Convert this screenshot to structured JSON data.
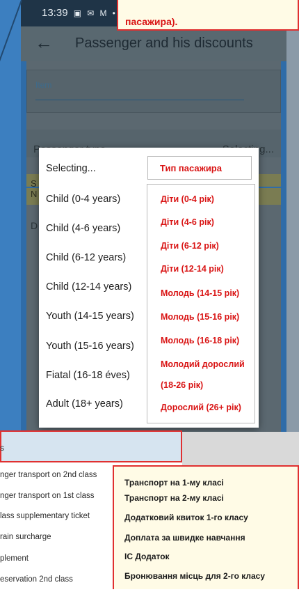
{
  "status_bar": {
    "time": "13:39",
    "icons": [
      "image-icon",
      "mail-icon",
      "gmail-icon",
      "dot-icon"
    ]
  },
  "header": {
    "back_glyph": "←",
    "title": "Passenger and his discounts"
  },
  "form": {
    "item_label": "Item",
    "passenger_type_label": "Passenger type",
    "passenger_type_value": "Selecting...",
    "band_line1": "S",
    "band_line2": "N",
    "d_line": "D"
  },
  "dropdown": {
    "options": [
      "Selecting...",
      "Child (0-4 years)",
      "Child (4-6 years)",
      "Child (6-12 years)",
      "Child (12-14 years)",
      "Youth (14-15 years)",
      "Youth (15-16 years)",
      "Fiatal (16-18 éves)",
      "Adult (18+  years)"
    ]
  },
  "annotations": {
    "top_note_line1": "",
    "top_note_line2": "пасажира).",
    "type_label": "Тип пасажира",
    "type_values": [
      "Діти (0-4 рік)",
      "Діти (4-6 рік)",
      "Діти (6-12 рік)",
      "Діти (12-14 рік)",
      "Молодь (14-15 рік)",
      "Молодь (15-16 рік)",
      "Молодь (16-18 рік)",
      "Молодий дорослий",
      "(18-26 рік)",
      "Дорослий (26+ рік)"
    ]
  },
  "bottom_list": {
    "header": "s",
    "rows": [
      "nger transport on 2nd class",
      "nger transport on 1st class",
      "lass supplementary ticket",
      "rain surcharge",
      "plement",
      "eservation 2nd class"
    ]
  },
  "bottom_translation": {
    "rows": [
      "Транспорт на 1-му класі",
      "Транспорт на 2-му класі",
      "Додатковий квиток 1-го класу",
      "Доплата за швидке навчання",
      "IC Додаток",
      "Бронювання місць для 2-го класу"
    ]
  }
}
